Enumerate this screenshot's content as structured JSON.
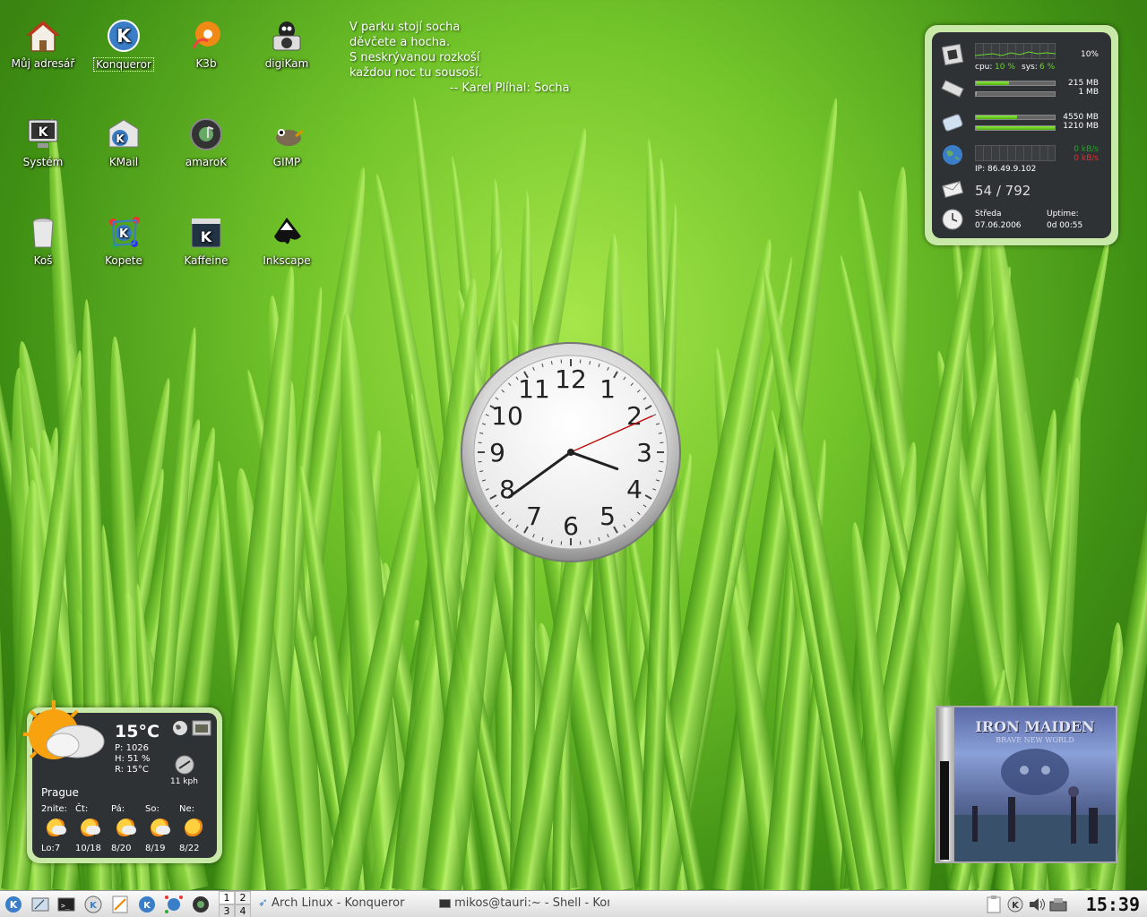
{
  "desktop": {
    "icons": [
      {
        "label": "Můj adresář",
        "icon": "home-folder-icon"
      },
      {
        "label": "Konqueror",
        "icon": "konqueror-icon",
        "selected": true
      },
      {
        "label": "K3b",
        "icon": "k3b-icon"
      },
      {
        "label": "digiKam",
        "icon": "digikam-icon"
      },
      {
        "label": "Systém",
        "icon": "system-icon"
      },
      {
        "label": "KMail",
        "icon": "kmail-icon"
      },
      {
        "label": "amaroK",
        "icon": "amarok-icon"
      },
      {
        "label": "GIMP",
        "icon": "gimp-icon"
      },
      {
        "label": "Koš",
        "icon": "trash-icon"
      },
      {
        "label": "Kopete",
        "icon": "kopete-icon"
      },
      {
        "label": "Kaffeine",
        "icon": "kaffeine-icon"
      },
      {
        "label": "Inkscape",
        "icon": "inkscape-icon"
      }
    ],
    "poem": {
      "lines": [
        "V parku stojí socha",
        "děvčete a hocha.",
        "S neskrývanou rozkoší",
        "každou noc tu sousoší."
      ],
      "author": "-- Karel Plíhal: Socha"
    }
  },
  "sysmon": {
    "cpu_percent": "10%",
    "cpu_label": "cpu:",
    "cpu_value": "10 %",
    "sys_label": "sys:",
    "sys_value": "6 %",
    "mem_used": "215 MB",
    "swap_used": "1 MB",
    "mem_fraction": 0.42,
    "swap_fraction": 0.01,
    "disk1": "4550 MB",
    "disk2": "1210 MB",
    "disk1_fraction": 0.52,
    "disk2_fraction": 1.0,
    "net_down": "0 kB/s",
    "net_up": "0 kB/s",
    "ip": "IP: 86.49.9.102",
    "mail_count": "54 / 792",
    "day": "Středa",
    "date": "07.06.2006",
    "uptime_label": "Uptime:",
    "uptime": "0d 00:55",
    "accent": "#6ad62c",
    "down_color": "#e03030"
  },
  "clock": {
    "numbers": [
      "12",
      "1",
      "2",
      "3",
      "4",
      "5",
      "6",
      "7",
      "8",
      "9",
      "10",
      "11"
    ],
    "hour": 3.66,
    "minute": 39,
    "second": 11
  },
  "weather": {
    "temp": "15°C",
    "pressure": "P: 1026",
    "humidity": "H: 51 %",
    "real": "R: 15°C",
    "wind": "11 kph",
    "city": "Prague",
    "days": [
      "2nite:",
      "Čt:",
      "Pá:",
      "So:",
      "Ne:"
    ],
    "temps": [
      "Lo:7",
      "10/18",
      "8/20",
      "8/19",
      "8/22"
    ]
  },
  "album": {
    "band": "IRON MAIDEN",
    "title": "BRAVE NEW WORLD"
  },
  "taskbar": {
    "pager": [
      "1",
      "2",
      "3",
      "4"
    ],
    "tasks": [
      "Arch Linux - Konqueror",
      "mikos@tauri:~ - Shell - Kor"
    ],
    "time": "15:39"
  }
}
